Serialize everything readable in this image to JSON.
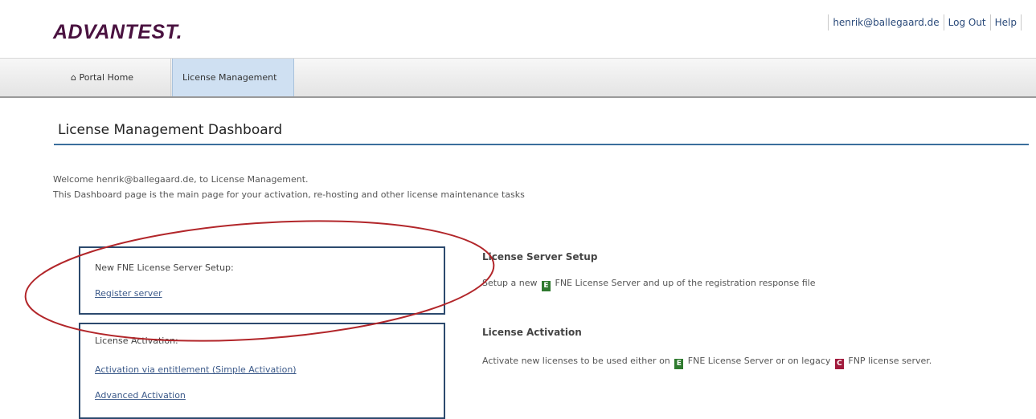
{
  "brand": {
    "logo": "ADVANTEST."
  },
  "header_links": {
    "user": "henrik@ballegaard.de",
    "logout": "Log Out",
    "help": "Help"
  },
  "nav": {
    "home_icon": "home-icon",
    "home": "Portal Home",
    "license_management": "License Management"
  },
  "page": {
    "title": "License Management Dashboard",
    "welcome": "Welcome henrik@ballegaard.de, to License Management.",
    "intro": "This Dashboard page is the main page for your activation, re-hosting and other license maintenance tasks"
  },
  "server_box": {
    "title": "New FNE License Server Setup:",
    "link": "Register server"
  },
  "activation_box": {
    "title": "License Activation:",
    "link_simple": "Activation via entitlement (Simple Activation)",
    "link_advanced": "Advanced Activation"
  },
  "server_desc": {
    "title": "License Server Setup",
    "pre": "Setup a new",
    "badge": "E",
    "post": "FNE License Server and up of the registration response file"
  },
  "activation_desc": {
    "title": "License Activation",
    "pre": "Activate new licenses to be used either on",
    "badge1": "E",
    "mid": "FNE License Server or on legacy",
    "badge2": "C",
    "post": "FNP license server."
  },
  "colors": {
    "brand": "#4a1240",
    "accent": "#3b6f9c",
    "highlight_ellipse": "#b2262a",
    "active_tab": "#cfe0f2"
  }
}
